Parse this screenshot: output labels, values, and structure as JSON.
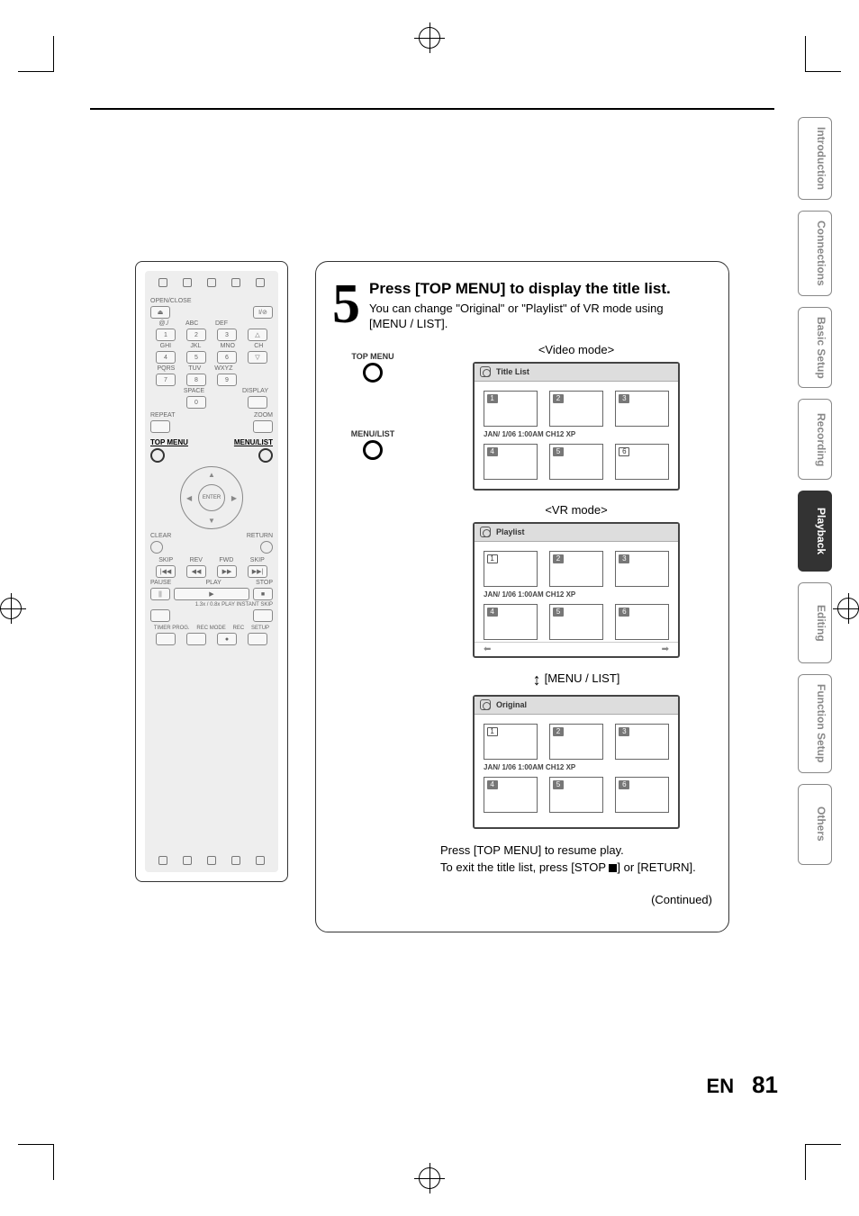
{
  "tabs": [
    "Introduction",
    "Connections",
    "Basic Setup",
    "Recording",
    "Playback",
    "Editing",
    "Function Setup",
    "Others"
  ],
  "active_tab_index": 4,
  "step": {
    "number": "5",
    "title": "Press [TOP MENU] to display the title list.",
    "desc1": "You can change \"Original\" or \"Playlist\" of  VR mode using",
    "desc2": "[MENU / LIST]."
  },
  "video_mode_label": "<Video mode>",
  "vr_mode_label": "<VR mode>",
  "toggle_label": "[MENU / LIST]",
  "btn_top_menu": "TOP MENU",
  "btn_menu_list": "MENU/LIST",
  "osd_title_list": {
    "header": "Title List",
    "caption": "JAN/ 1/06 1:00AM CH12 XP",
    "r1": [
      "1",
      "2",
      "3"
    ],
    "r2": [
      "4",
      "5",
      "6"
    ],
    "r2_selected": 2
  },
  "osd_playlist": {
    "header": "Playlist",
    "caption": "JAN/ 1/06 1:00AM CH12 XP",
    "r1": [
      "1",
      "2",
      "3"
    ],
    "r2": [
      "4",
      "5",
      "6"
    ],
    "r1_selected": 0
  },
  "osd_original": {
    "header": "Original",
    "caption": "JAN/ 1/06 1:00AM CH12 XP",
    "r1": [
      "1",
      "2",
      "3"
    ],
    "r2": [
      "4",
      "5",
      "6"
    ],
    "r1_selected": 0
  },
  "post1": "Press [TOP MENU] to resume play.",
  "post2a": "To exit the title list, press [STOP ",
  "post2b": "] or [RETURN].",
  "continued": "(Continued)",
  "footer_lang": "EN",
  "footer_page": "81",
  "remote": {
    "open_close": "OPEN/CLOSE",
    "power": "I/⊘",
    "eject": "⏏",
    "row1_labels": [
      "@./",
      "ABC",
      "DEF",
      ""
    ],
    "row1": [
      "1",
      "2",
      "3",
      "△"
    ],
    "row2_labels": [
      "GHI",
      "JKL",
      "MNO",
      "CH"
    ],
    "row2": [
      "4",
      "5",
      "6",
      "▽"
    ],
    "row3_labels": [
      "PQRS",
      "TUV",
      "WXYZ",
      ""
    ],
    "row3": [
      "7",
      "8",
      "9"
    ],
    "row4_labels": [
      "",
      "SPACE",
      "",
      "DISPLAY"
    ],
    "row4": [
      "",
      "0",
      "",
      ""
    ],
    "repeat": "REPEAT",
    "zoom": "ZOOM",
    "top_menu": "TOP MENU",
    "menu_list": "MENU/LIST",
    "enter": "ENTER",
    "clear": "CLEAR",
    "return": "RETURN",
    "transport_labels": [
      "SKIP",
      "REV",
      "FWD",
      "SKIP"
    ],
    "transport": [
      "|◀◀",
      "◀◀",
      "▶▶",
      "▶▶|"
    ],
    "transport2_labels": [
      "PAUSE",
      "PLAY",
      "STOP"
    ],
    "transport2": [
      "||",
      "▶",
      "■"
    ],
    "instant": "1.3x / 0.8x PLAY   INSTANT SKIP",
    "bottom_labels": [
      "TIMER PROG.",
      "REC MODE",
      "REC",
      "SETUP"
    ]
  }
}
